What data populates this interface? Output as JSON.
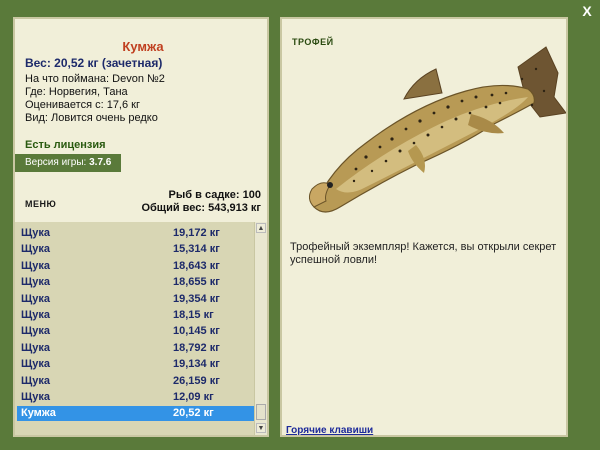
{
  "window": {
    "close_label": "X"
  },
  "fish": {
    "name": "Кумжа",
    "weight_line": "Вес: 20,52 кг (зачетная)",
    "bait_line": "На что поймана: Devon №2",
    "place_line": "Где: Норвегия, Тана",
    "rated_line": "Оценивается с: 17,6 кг",
    "kind_line": "Вид: Ловится очень редко"
  },
  "license": "Есть лицензия",
  "version": {
    "label": "Версия игры:",
    "value": "3.7.6"
  },
  "menu_label": "МЕНЮ",
  "cage": {
    "count_line": "Рыб в садке: 100",
    "total_line": "Общий вес: 543,913 кг"
  },
  "catch_list": [
    {
      "name": "Щука",
      "weight": "19,172 кг"
    },
    {
      "name": "Щука",
      "weight": "15,314 кг"
    },
    {
      "name": "Щука",
      "weight": "18,643 кг"
    },
    {
      "name": "Щука",
      "weight": "18,655 кг"
    },
    {
      "name": "Щука",
      "weight": "19,354 кг"
    },
    {
      "name": "Щука",
      "weight": "18,15 кг"
    },
    {
      "name": "Щука",
      "weight": "10,145 кг"
    },
    {
      "name": "Щука",
      "weight": "18,792 кг"
    },
    {
      "name": "Щука",
      "weight": "19,134 кг"
    },
    {
      "name": "Щука",
      "weight": "26,159 кг"
    },
    {
      "name": "Щука",
      "weight": "12,09 кг"
    },
    {
      "name": "Кумжа",
      "weight": "20,52 кг",
      "selected": true
    }
  ],
  "trophy": {
    "title": "ТРОФЕЙ",
    "description": "Трофейный экземпляр! Кажется, вы открыли секрет успешной ловли!",
    "hotkeys_link": "Горячие клавиши"
  },
  "colors": {
    "accent_green": "#5a7a3a",
    "panel_bg": "#f1efd9",
    "selection": "#3393e6",
    "name_red": "#c04020",
    "text_blue": "#1d2a6a"
  }
}
